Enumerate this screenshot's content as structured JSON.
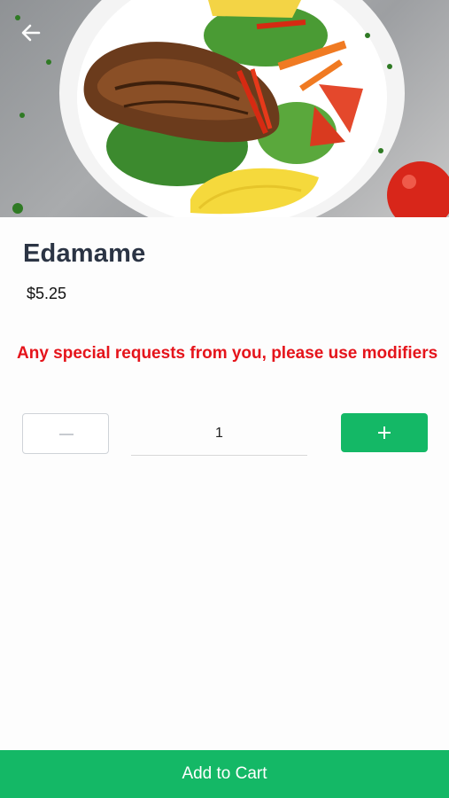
{
  "header": {
    "back_icon": "arrow-left-icon",
    "image": "salad-photo"
  },
  "product": {
    "name": "Edamame",
    "price": "$5.25"
  },
  "notice": "Any special requests from you, please use modifiers",
  "quantity": {
    "value": "1",
    "decrement_icon": "minus-icon",
    "increment_icon": "plus-icon"
  },
  "footer": {
    "add_to_cart_label": "Add to Cart"
  },
  "colors": {
    "accent": "#14b866",
    "notice": "#e5141b",
    "title": "#2b3444"
  }
}
